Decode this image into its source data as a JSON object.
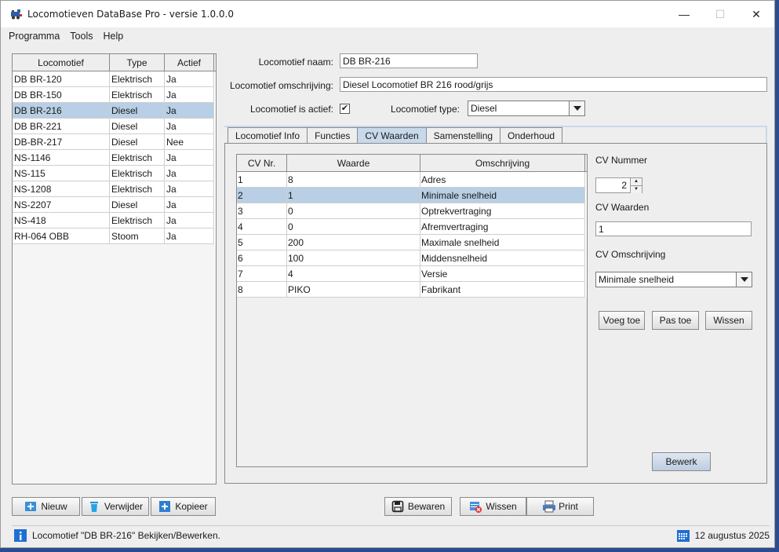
{
  "window": {
    "title": "Locomotieven DataBase Pro - versie 1.0.0.0",
    "icon": "locomotive-icon",
    "controls": {
      "minimize": "—",
      "maximize": "☐",
      "close": "✕"
    }
  },
  "menu": [
    "Programma",
    "Tools",
    "Help"
  ],
  "loco_table": {
    "headers": [
      "Locomotief",
      "Type",
      "Actief"
    ],
    "rows": [
      [
        "DB BR-120",
        "Elektrisch",
        "Ja"
      ],
      [
        "DB BR-150",
        "Elektrisch",
        "Ja"
      ],
      [
        "DB BR-216",
        "Diesel",
        "Ja"
      ],
      [
        "DB BR-221",
        "Diesel",
        "Ja"
      ],
      [
        "DB-BR-217",
        "Diesel",
        "Nee"
      ],
      [
        "NS-1146",
        "Elektrisch",
        "Ja"
      ],
      [
        "NS-115",
        "Elektrisch",
        "Ja"
      ],
      [
        "NS-1208",
        "Elektrisch",
        "Ja"
      ],
      [
        "NS-2207",
        "Diesel",
        "Ja"
      ],
      [
        "NS-418",
        "Elektrisch",
        "Ja"
      ],
      [
        "RH-064 OBB",
        "Stoom",
        "Ja"
      ]
    ],
    "selected_index": 2
  },
  "form": {
    "name_label": "Locomotief naam:",
    "name_value": "DB BR-216",
    "desc_label": "Locomotief omschrijving:",
    "desc_value": "Diesel Locomotief BR 216 rood/grijs",
    "active_label": "Locomotief is actief:",
    "active_checked": true,
    "check_mark": "✔",
    "type_label": "Locomotief type:",
    "type_value": "Diesel"
  },
  "tabs": [
    "Locomotief Info",
    "Functies",
    "CV Waarden",
    "Samenstelling",
    "Onderhoud"
  ],
  "active_tab": "CV Waarden",
  "cv_table": {
    "headers": [
      "CV Nr.",
      "Waarde",
      "Omschrijving"
    ],
    "rows": [
      [
        "1",
        "8",
        "Adres"
      ],
      [
        "2",
        "1",
        "Minimale snelheid"
      ],
      [
        "3",
        "0",
        "Optrekvertraging"
      ],
      [
        "4",
        "0",
        "Afremvertraging"
      ],
      [
        "5",
        "200",
        "Maximale snelheid"
      ],
      [
        "6",
        "100",
        "Middensnelheid"
      ],
      [
        "7",
        "4",
        "Versie"
      ],
      [
        "8",
        "PIKO",
        "Fabrikant"
      ]
    ],
    "selected_index": 1
  },
  "cv_editor": {
    "nummer_label": "CV Nummer",
    "nummer_value": "2",
    "waarden_label": "CV Waarden",
    "waarden_value": "1",
    "omschrijving_label": "CV Omschrijving",
    "omschrijving_value": "Minimale snelheid",
    "voeg_toe": "Voeg toe",
    "pas_toe": "Pas toe",
    "wissen": "Wissen",
    "bewerk": "Bewerk"
  },
  "bottom_buttons": {
    "nieuw": "Nieuw",
    "verwijder": "Verwijder",
    "kopieer": "Kopieer",
    "bewaren": "Bewaren",
    "wissen": "Wissen",
    "print": "Print"
  },
  "status": {
    "message": "Locomotief \"DB BR-216\" Bekijken/Bewerken.",
    "date": "12 augustus 2025"
  },
  "colors": {
    "selection": "#b8cfe5",
    "active_tab": "#c8d9eb",
    "info_icon": "#1f6fd1"
  }
}
